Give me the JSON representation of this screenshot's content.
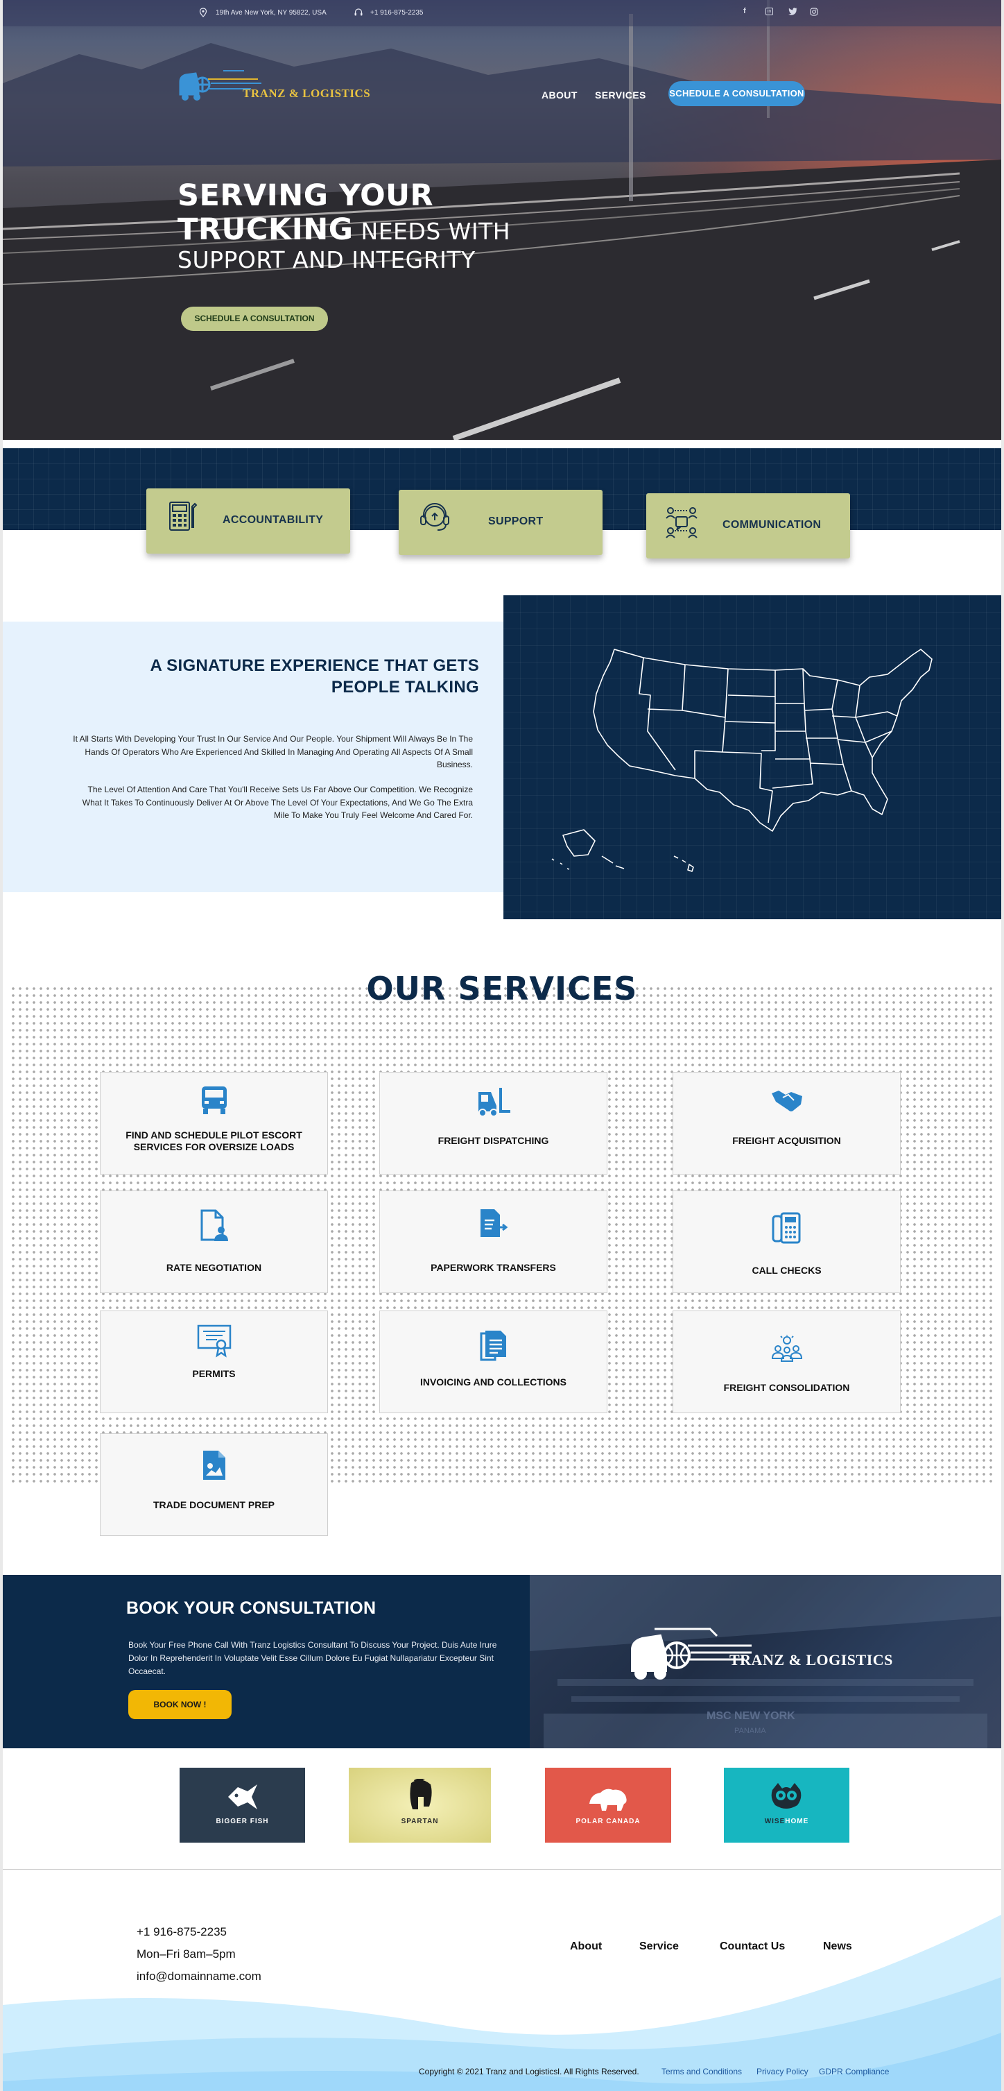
{
  "topbar": {
    "address": "19th Ave New York, NY 95822, USA",
    "phone": "+1 916-875-2235",
    "social_icons": [
      "facebook-icon",
      "linkedin-icon",
      "twitter-icon",
      "instagram-icon"
    ]
  },
  "brand": {
    "name": "TRANZ & LOGISTICS"
  },
  "nav": {
    "items": [
      "ABOUT",
      "SERVICES"
    ],
    "cta": "SCHEDULE A CONSULTATION"
  },
  "hero": {
    "line1": "SERVING YOUR",
    "line2_bold": "TRUCKING",
    "line2_thin": " NEEDS WITH",
    "line3": "SUPPORT AND INTEGRITY",
    "cta": "SCHEDULE A CONSULTATION"
  },
  "values": [
    {
      "label": "ACCOUNTABILITY",
      "icon": "calculator-icon"
    },
    {
      "label": "SUPPORT",
      "icon": "headset-icon"
    },
    {
      "label": "COMMUNICATION",
      "icon": "team-communication-icon"
    }
  ],
  "signature": {
    "title": "A SIGNATURE EXPERIENCE THAT GETS PEOPLE TALKING",
    "paragraph1": "It All Starts With Developing Your Trust In Our Service And Our People. Your Shipment Will Always Be In The Hands Of Operators Who Are Experienced And Skilled In Managing And Operating All Aspects Of A Small Business.",
    "paragraph2": "The Level Of Attention And Care That You'll Receive Sets Us Far Above Our Competition. We Recognize What It Takes To Continuously Deliver At Or Above The Level Of Your Expectations, And We Go The Extra Mile To Make You Truly Feel Welcome And Cared For."
  },
  "services": {
    "title": "OUR SERVICES",
    "items": [
      {
        "label": "FIND AND SCHEDULE PILOT ESCORT SERVICES FOR OVERSIZE LOADS",
        "icon": "truck-icon"
      },
      {
        "label": "FREIGHT DISPATCHING",
        "icon": "forklift-icon"
      },
      {
        "label": "FREIGHT ACQUISITION",
        "icon": "handshake-icon"
      },
      {
        "label": "RATE NEGOTIATION",
        "icon": "document-user-icon"
      },
      {
        "label": "PAPERWORK TRANSFERS",
        "icon": "document-transfer-icon"
      },
      {
        "label": "CALL CHECKS",
        "icon": "phone-icon"
      },
      {
        "label": "PERMITS",
        "icon": "certificate-icon"
      },
      {
        "label": "INVOICING AND COLLECTIONS",
        "icon": "documents-icon"
      },
      {
        "label": "FREIGHT CONSOLIDATION",
        "icon": "group-idea-icon"
      },
      {
        "label": "TRADE DOCUMENT PREP",
        "icon": "document-image-icon"
      }
    ]
  },
  "consultation": {
    "title": "BOOK YOUR CONSULTATION",
    "text": "Book Your Free Phone Call With Tranz Logistics Consultant To Discuss Your Project. Duis Aute Irure Dolor In Reprehenderit In Voluptate Velit Esse Cillum Dolore Eu Fugiat Nullapariatur Excepteur Sint Occaecat.",
    "cta": "BOOK NOW !",
    "logo_text": "TRANZ & LOGISTICS"
  },
  "partners": [
    {
      "name": "BIGGER FISH",
      "bg": "#2b3c4e"
    },
    {
      "name": "SPARTAN",
      "bg": "#e6e19a"
    },
    {
      "name": "POLAR CANADA",
      "bg": "#e2584a"
    },
    {
      "name_dark": "WISE",
      "name_light": "HOME",
      "bg": "#17b6c0"
    }
  ],
  "footer": {
    "phone": "+1 916-875-2235",
    "hours": "Mon–Fri 8am–5pm",
    "email": "info@domainname.com",
    "nav": [
      "About",
      "Service",
      "Countact Us",
      "News"
    ],
    "copyright": "Copyright © 2021 Tranz and Logisticsl. All Rights Reserved.",
    "links": [
      "Terms and Conditions",
      "Privacy Policy",
      "GDPR Compliance"
    ]
  },
  "colors": {
    "navy": "#0c2a4a",
    "accent_blue": "#3a93d6",
    "olive": "#c3cb8e",
    "yellow": "#f2b705"
  }
}
